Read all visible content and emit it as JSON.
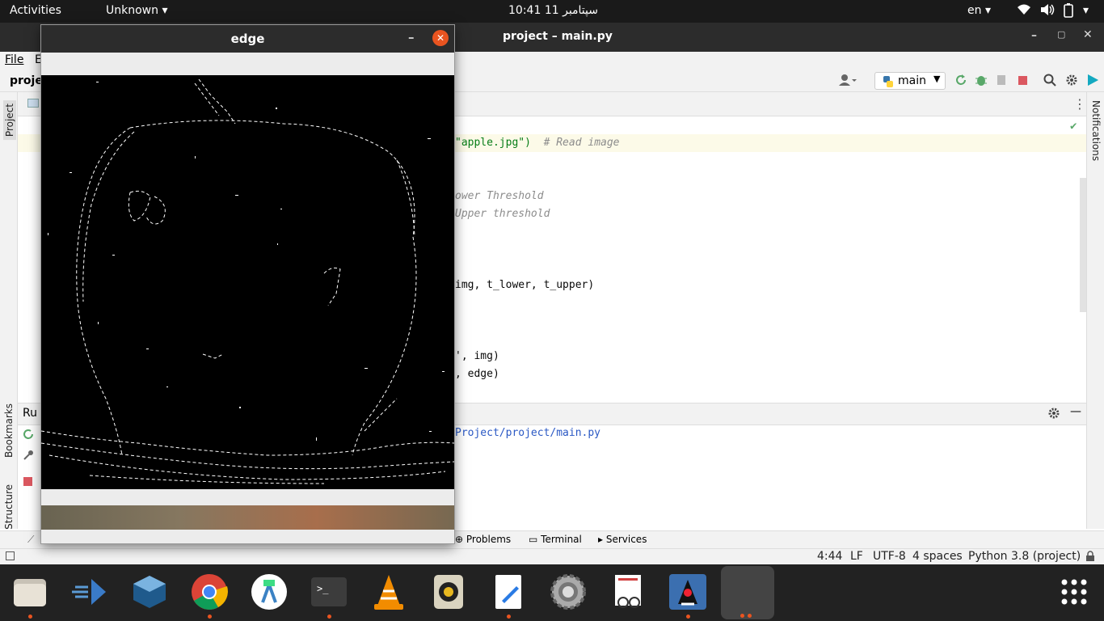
{
  "topbar": {
    "activities": "Activities",
    "app_menu": "Unknown",
    "clock": "سپتامبر 11  10:41",
    "lang": "en"
  },
  "ide": {
    "title": "project – main.py",
    "menu": {
      "file": "File",
      "edit": "E"
    },
    "project_crumb": "proje",
    "run_config": "main",
    "code": {
      "line_read": "\"apple.jpg\")",
      "line_read_comment": "# Read image",
      "line_lower": "ower Threshold",
      "line_upper": "Upper threshold",
      "line_canny": "img, t_lower, t_upper)",
      "line_show1": "', img)",
      "line_show2": ", edge)"
    },
    "run_label": "Ru",
    "run_output": "Project/project/main.py",
    "left_tabs": {
      "project": "Project",
      "bookmarks": "Bookmarks",
      "structure": "Structure"
    },
    "right_tabs": {
      "notifications": "Notifications"
    },
    "bottom_tabs": {
      "problems": "Problems",
      "terminal": "Terminal",
      "services": "Services"
    },
    "status": {
      "position": "4:44",
      "line_ending": "LF",
      "encoding": "UTF-8",
      "indent": "4 spaces",
      "interpreter": "Python 3.8 (project)"
    }
  },
  "cv_window": {
    "title": "edge"
  },
  "dock": {
    "items": [
      "files-icon",
      "sticky-code-icon",
      "virtualbox-icon",
      "chrome-icon",
      "android-studio-icon",
      "terminal-icon",
      "vlc-icon",
      "rhythmbox-icon",
      "text-editor-icon",
      "settings-icon",
      "document-viewer-icon",
      "java-duke-icon",
      "show-apps-icon"
    ]
  }
}
